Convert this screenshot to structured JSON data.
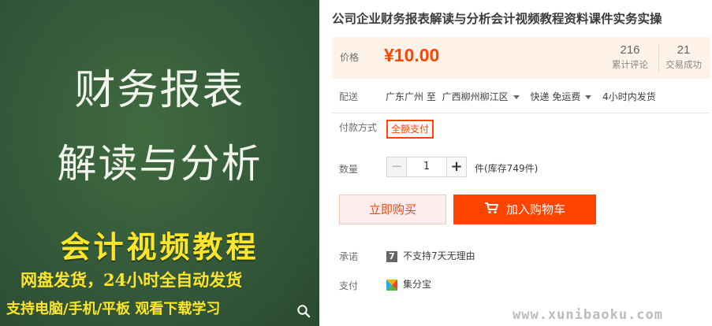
{
  "gallery": {
    "line1": "财务报表",
    "line2": "解读与分析",
    "line3": "会计视频教程",
    "line4": "网盘发货，24小时全自动发货",
    "line5": "支持电脑/手机/平板 观看下载学习",
    "zoom_icon": "magnifier-icon"
  },
  "product": {
    "title": "公司企业财务报表解读与分析会计视频教程资料课件实务实操"
  },
  "price": {
    "label": "价格",
    "value": "¥10.00",
    "reviews_count": "216",
    "reviews_label": "累计评论",
    "sales_count": "21",
    "sales_label": "交易成功"
  },
  "delivery": {
    "label": "配送",
    "from": "广东广州 至",
    "to": "广西柳州柳江区",
    "method": "快递 免运费",
    "ship_time": "4小时内发货"
  },
  "payment_method": {
    "label": "付款方式",
    "option": "全额支付"
  },
  "quantity": {
    "label": "数量",
    "minus": "−",
    "value": "1",
    "plus": "+",
    "stock": "件(库存749件)"
  },
  "actions": {
    "buy_now": "立即购买",
    "add_to_cart": "加入购物车"
  },
  "promise": {
    "label": "承诺",
    "badge": "7",
    "text": "不支持7天无理由"
  },
  "pay": {
    "label": "支付",
    "text": "集分宝"
  },
  "watermark": "www.xunibaoku.com",
  "colors": {
    "accent": "#ff4400",
    "price_bg": "#fff2e8",
    "board_green": "#34593a",
    "chalk_yellow": "#ffe52a"
  }
}
